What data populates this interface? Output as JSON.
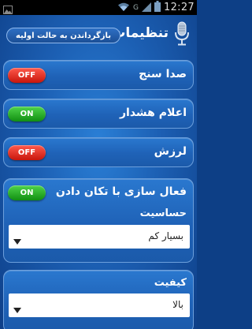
{
  "status_bar": {
    "network": "G",
    "time": "12:27",
    "icons": [
      "image-notification-icon",
      "wifi-icon",
      "signal-icon",
      "battery-icon"
    ]
  },
  "header": {
    "title": "تنظیمات",
    "reset_label": "بازگرداندن به حالت اولیه",
    "icon": "microphone-icon"
  },
  "settings": {
    "sound_meter": {
      "label": "صدا سنج",
      "state": "OFF"
    },
    "alert": {
      "label": "اعلام هشدار",
      "state": "ON"
    },
    "vibration": {
      "label": "لرزش",
      "state": "OFF"
    },
    "shake": {
      "label": "فعال سازی با تکان دادن",
      "state": "ON",
      "sensitivity_label": "حساسیت",
      "sensitivity_value": "بسیار کم"
    },
    "quality": {
      "label": "کیفیت",
      "value": "بالا"
    }
  },
  "colors": {
    "on": "#2bb82a",
    "off": "#e8291c",
    "background": "#1c5fb3",
    "status_bar": "#000000"
  }
}
